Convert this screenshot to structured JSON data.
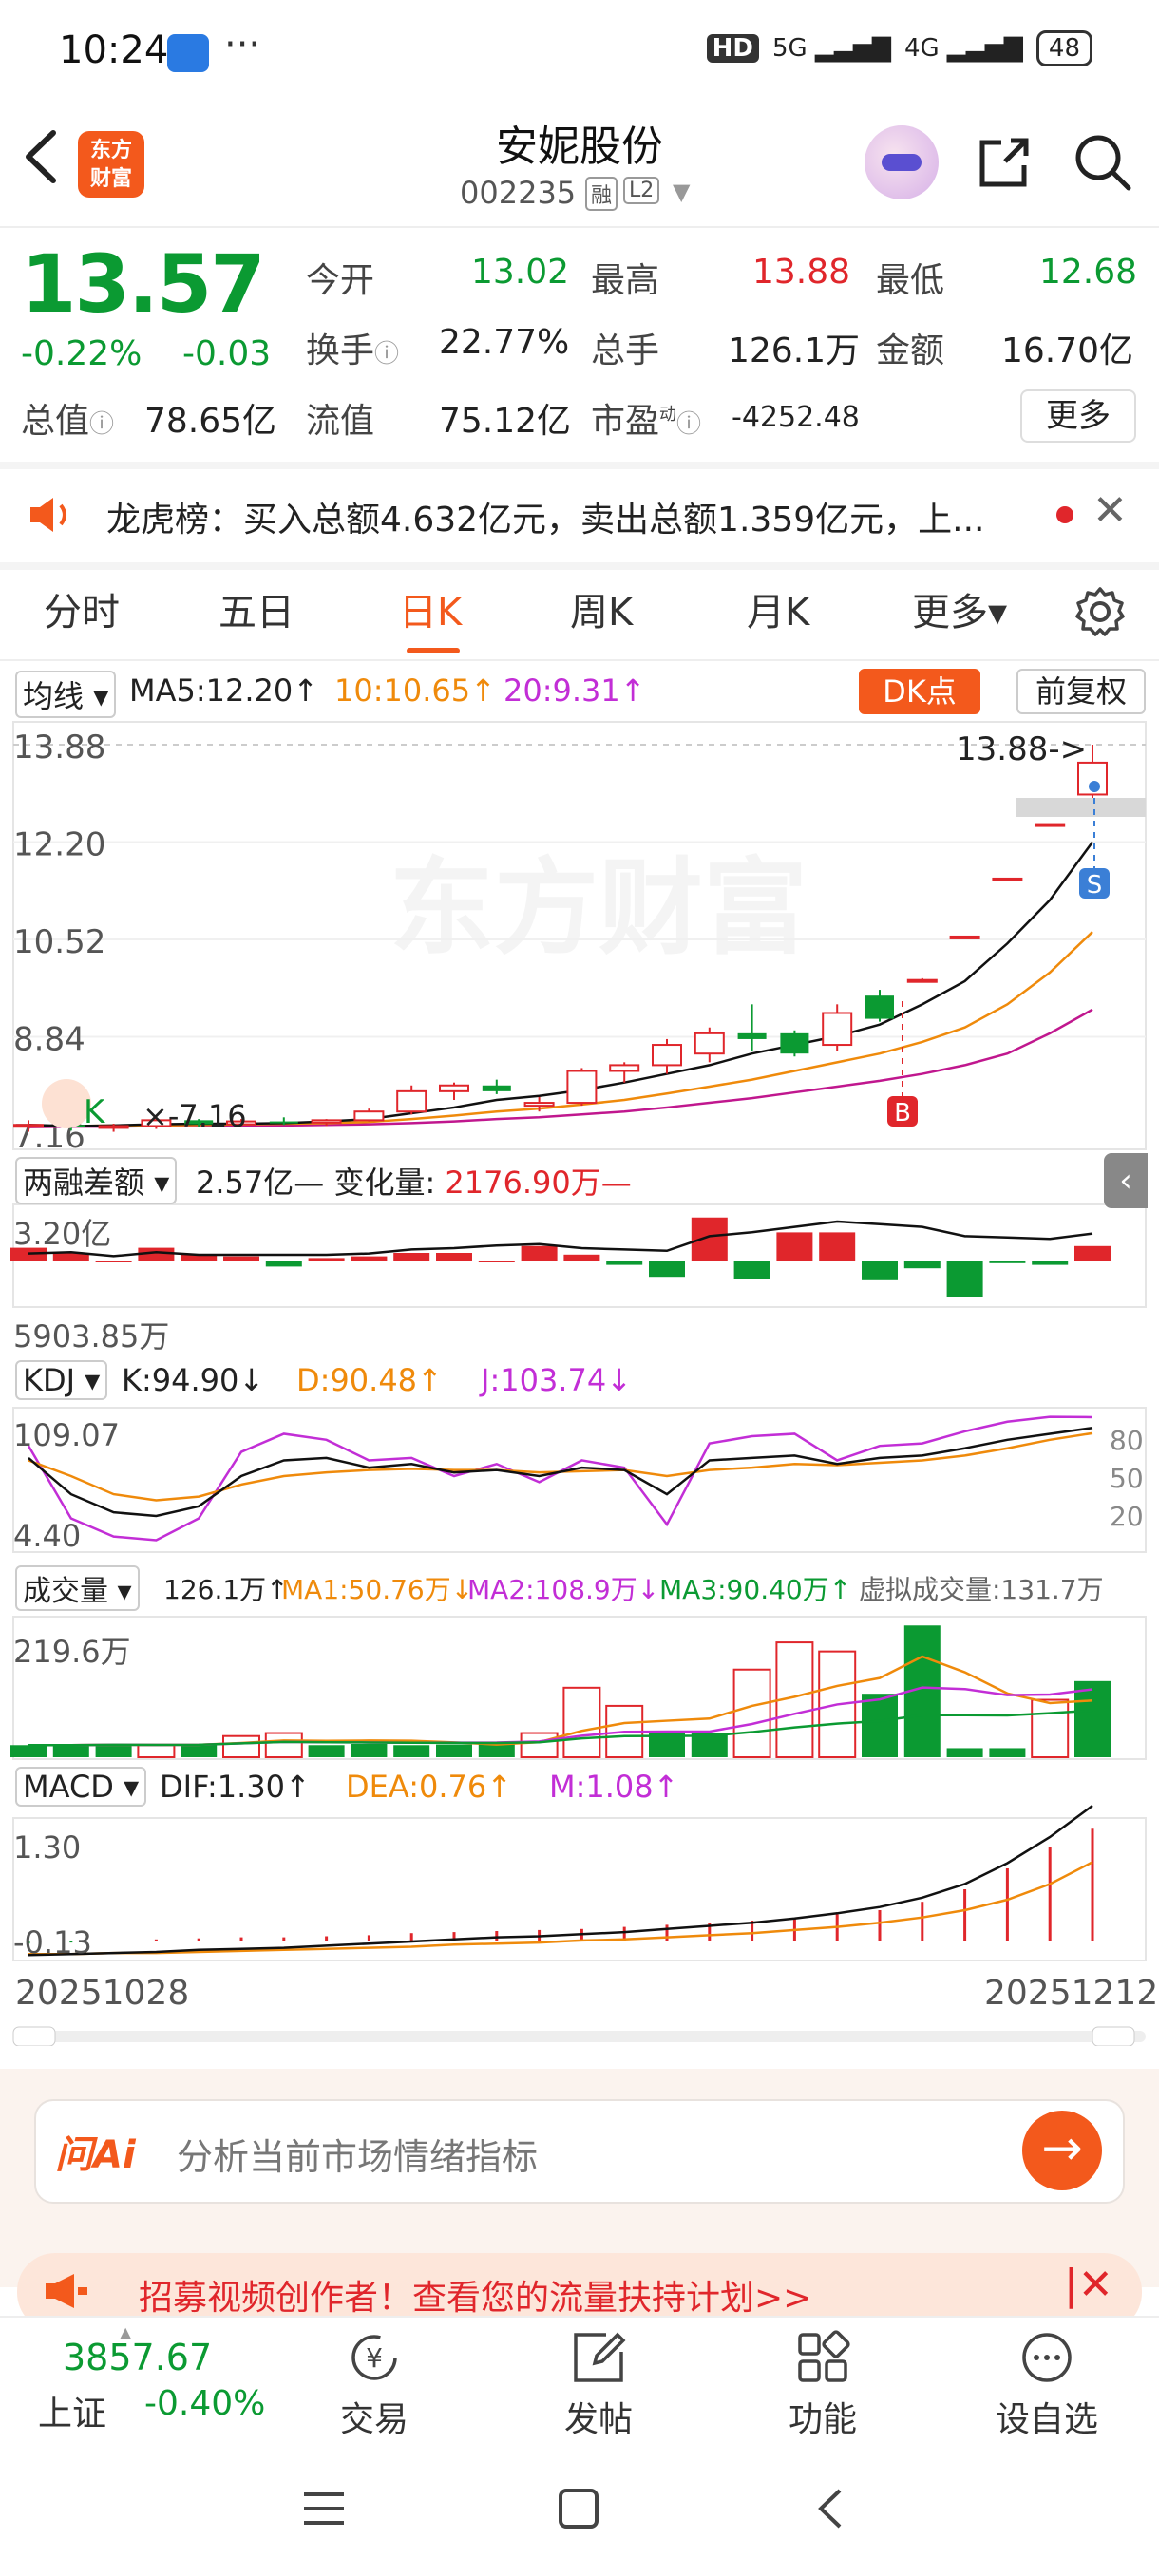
{
  "status": {
    "time": "10:24",
    "dots": "···",
    "hd": "HD",
    "net1": "5G",
    "net2": "4G",
    "battery": "48"
  },
  "header": {
    "logo_line1": "东方",
    "logo_line2": "财富",
    "name": "安妮股份",
    "code": "002235",
    "badge_rong": "融",
    "badge_l2": "L2"
  },
  "quote": {
    "price": "13.57",
    "pct": "-0.22%",
    "chg": "-0.03",
    "rows": [
      [
        {
          "l": "今开",
          "v": "13.02",
          "c": "green"
        },
        {
          "l": "最高",
          "v": "13.88",
          "c": "red"
        },
        {
          "l": "最低",
          "v": "12.68",
          "c": "green"
        }
      ],
      [
        {
          "l": "换手",
          "v": "22.77%",
          "c": "gray"
        },
        {
          "l": "总手",
          "v": "126.1万",
          "c": "gray"
        },
        {
          "l": "金额",
          "v": "16.70亿",
          "c": "gray"
        }
      ]
    ],
    "total_cap_label": "总值",
    "total_cap": "78.65亿",
    "float_cap_label": "流值",
    "float_cap": "75.12亿",
    "pe_label": "市盈",
    "pe_sup": "动",
    "pe": "-4252.48",
    "more": "更多"
  },
  "news": {
    "text": "龙虎榜：买入总额4.632亿元，卖出总额1.359亿元，上..."
  },
  "tabs": [
    {
      "label": "分时"
    },
    {
      "label": "五日"
    },
    {
      "label": "日K",
      "active": true
    },
    {
      "label": "周K"
    },
    {
      "label": "月K"
    },
    {
      "label": "更多▾"
    }
  ],
  "kline": {
    "indicator": "均线",
    "ma5": "MA5:12.20↑",
    "ma10": "10:10.65↑",
    "ma20": "20:9.31↑",
    "dk": "DK点",
    "fq": "前复权",
    "y_labels": [
      "13.88",
      "12.20",
      "10.52",
      "8.84",
      "7.16"
    ],
    "high_marker": "13.88->",
    "s_mark": "S",
    "b_mark": "B",
    "watermark": "东方财富",
    "k_label": "K",
    "x_label": "×-7.16"
  },
  "margin": {
    "label": "两融差额",
    "value": "2.57亿",
    "change_label": "变化量:",
    "change": "2176.90万",
    "y_top": "3.20亿",
    "y_bottom": "5903.85万"
  },
  "kdj": {
    "label": "KDJ",
    "k": "K:94.90↓",
    "d": "D:90.48↑",
    "j": "J:103.74↓",
    "y_top": "109.07",
    "y_bottom": "4.40",
    "levels": [
      "80",
      "50",
      "20"
    ]
  },
  "volume": {
    "label": "成交量",
    "total": "126.1万↑",
    "ma1": "MA1:50.76万↓",
    "ma2": "MA2:108.9万↓",
    "ma3": "MA3:90.40万↑",
    "virtual": "虚拟成交量:131.7万",
    "y_top": "219.6万"
  },
  "macd": {
    "label": "MACD",
    "dif": "DIF:1.30↑",
    "dea": "DEA:0.76↑",
    "m": "M:1.08↑",
    "y_top": "1.30",
    "y_bottom": "-0.13"
  },
  "dates": {
    "start": "20251028",
    "end": "20251212"
  },
  "ai": {
    "logo": "问Ai",
    "placeholder": "分析当前市场情绪指标",
    "go": "→"
  },
  "promo": {
    "text": "招募视频创作者！查看您的流量扶持计划>>"
  },
  "bottom": {
    "index_value": "3857.67",
    "index_name": "上证",
    "index_pct": "-0.40%",
    "items": [
      {
        "label": "交易"
      },
      {
        "label": "发帖"
      },
      {
        "label": "功能"
      },
      {
        "label": "设自选"
      }
    ]
  },
  "chart_data": {
    "type": "candlestick",
    "title": "安妮股份 日K",
    "x_range": [
      "20251028",
      "20251212"
    ],
    "ylim": [
      7.16,
      13.88
    ],
    "ohlc": [
      [
        7.3,
        7.4,
        7.2,
        7.32
      ],
      [
        7.32,
        7.35,
        7.22,
        7.28
      ],
      [
        7.28,
        7.34,
        7.2,
        7.3
      ],
      [
        7.3,
        7.45,
        7.25,
        7.4
      ],
      [
        7.4,
        7.42,
        7.28,
        7.33
      ],
      [
        7.33,
        7.42,
        7.3,
        7.38
      ],
      [
        7.38,
        7.45,
        7.32,
        7.36
      ],
      [
        7.36,
        7.42,
        7.3,
        7.4
      ],
      [
        7.4,
        7.6,
        7.38,
        7.55
      ],
      [
        7.55,
        8.0,
        7.5,
        7.9
      ],
      [
        7.9,
        8.05,
        7.75,
        8.0
      ],
      [
        8.0,
        8.1,
        7.85,
        7.9
      ],
      [
        7.65,
        7.8,
        7.55,
        7.7
      ],
      [
        7.7,
        8.3,
        7.65,
        8.25
      ],
      [
        8.25,
        8.4,
        8.05,
        8.35
      ],
      [
        8.35,
        8.8,
        8.2,
        8.7
      ],
      [
        8.55,
        9.0,
        8.4,
        8.9
      ],
      [
        8.9,
        9.4,
        8.6,
        8.8
      ],
      [
        8.9,
        8.95,
        8.5,
        8.55
      ],
      [
        8.7,
        9.4,
        8.6,
        9.25
      ],
      [
        9.55,
        9.65,
        9.1,
        9.15
      ],
      [
        9.8,
        9.85,
        9.8,
        9.82
      ],
      [
        10.55,
        10.58,
        10.55,
        10.57
      ],
      [
        11.55,
        11.58,
        11.55,
        11.57
      ],
      [
        12.5,
        12.52,
        12.5,
        12.51
      ],
      [
        13.02,
        13.88,
        12.68,
        13.57
      ]
    ],
    "ma5": [
      7.32,
      7.3,
      7.31,
      7.33,
      7.34,
      7.34,
      7.35,
      7.38,
      7.42,
      7.52,
      7.62,
      7.75,
      7.82,
      7.92,
      8.05,
      8.2,
      8.35,
      8.55,
      8.7,
      8.85,
      9.05,
      9.4,
      9.8,
      10.45,
      11.2,
      12.2
    ],
    "ma10": [
      7.3,
      7.3,
      7.31,
      7.31,
      7.32,
      7.33,
      7.34,
      7.35,
      7.37,
      7.42,
      7.48,
      7.55,
      7.6,
      7.67,
      7.75,
      7.86,
      7.98,
      8.1,
      8.25,
      8.4,
      8.55,
      8.75,
      9.0,
      9.4,
      9.95,
      10.65
    ],
    "ma20": [
      7.28,
      7.29,
      7.29,
      7.3,
      7.3,
      7.31,
      7.31,
      7.32,
      7.33,
      7.35,
      7.38,
      7.42,
      7.45,
      7.5,
      7.55,
      7.62,
      7.7,
      7.78,
      7.88,
      7.98,
      8.08,
      8.2,
      8.35,
      8.55,
      8.9,
      9.31
    ],
    "volume_wan": [
      20,
      20,
      22,
      20,
      21,
      35,
      40,
      20,
      22,
      20,
      21,
      22,
      40,
      115,
      85,
      40,
      40,
      145,
      190,
      175,
      105,
      218,
      15,
      15,
      95,
      126
    ],
    "volume_up": [
      false,
      false,
      false,
      true,
      false,
      true,
      true,
      false,
      false,
      false,
      false,
      false,
      true,
      true,
      true,
      false,
      false,
      true,
      true,
      true,
      false,
      false,
      false,
      false,
      true,
      false
    ],
    "margin_bars": [
      0.8,
      0.5,
      0,
      0.8,
      0.4,
      0.3,
      -0.3,
      0.2,
      0.3,
      0.5,
      0.5,
      0,
      0.9,
      0.4,
      -0.2,
      -0.9,
      2.57,
      -1.0,
      1.7,
      1.7,
      -1.1,
      -0.4,
      -2.1,
      -0.1,
      -0.2,
      0.9
    ],
    "margin_line": [
      0.6,
      0.7,
      0.4,
      0.7,
      0.5,
      0.5,
      0.5,
      0.5,
      0.6,
      0.9,
      1.0,
      1.2,
      1.3,
      1.0,
      0.9,
      0.8,
      1.9,
      2.2,
      2.6,
      3.0,
      2.8,
      2.6,
      1.9,
      1.8,
      1.7,
      2.1
    ],
    "kdj_k": [
      70,
      40,
      25,
      22,
      30,
      55,
      68,
      70,
      62,
      65,
      58,
      60,
      55,
      62,
      60,
      40,
      68,
      70,
      72,
      65,
      70,
      72,
      78,
      85,
      90,
      94.9
    ],
    "kdj_d": [
      68,
      55,
      40,
      35,
      38,
      48,
      55,
      58,
      60,
      61,
      60,
      60,
      58,
      59,
      60,
      55,
      60,
      62,
      65,
      64,
      66,
      68,
      72,
      78,
      85,
      90.48
    ],
    "kdj_j": [
      80,
      20,
      5,
      2,
      20,
      75,
      90,
      85,
      68,
      70,
      55,
      65,
      50,
      68,
      62,
      15,
      82,
      88,
      90,
      68,
      80,
      82,
      92,
      100,
      104,
      103.74
    ],
    "macd_dif": [
      -0.13,
      -0.12,
      -0.11,
      -0.1,
      -0.08,
      -0.07,
      -0.06,
      -0.04,
      -0.02,
      0.0,
      0.02,
      0.04,
      0.05,
      0.07,
      0.09,
      0.12,
      0.15,
      0.18,
      0.22,
      0.27,
      0.33,
      0.42,
      0.55,
      0.75,
      1.0,
      1.3
    ],
    "macd_dea": [
      -0.12,
      -0.12,
      -0.11,
      -0.11,
      -0.1,
      -0.09,
      -0.08,
      -0.07,
      -0.06,
      -0.05,
      -0.03,
      -0.02,
      -0.01,
      0.01,
      0.02,
      0.04,
      0.06,
      0.08,
      0.11,
      0.14,
      0.18,
      0.23,
      0.3,
      0.4,
      0.55,
      0.76
    ],
    "macd_bar": [
      -0.02,
      -0.01,
      0,
      0.02,
      0.03,
      0.04,
      0.04,
      0.05,
      0.06,
      0.08,
      0.09,
      0.1,
      0.11,
      0.12,
      0.14,
      0.16,
      0.18,
      0.2,
      0.22,
      0.26,
      0.3,
      0.38,
      0.5,
      0.7,
      0.9,
      1.08
    ]
  }
}
